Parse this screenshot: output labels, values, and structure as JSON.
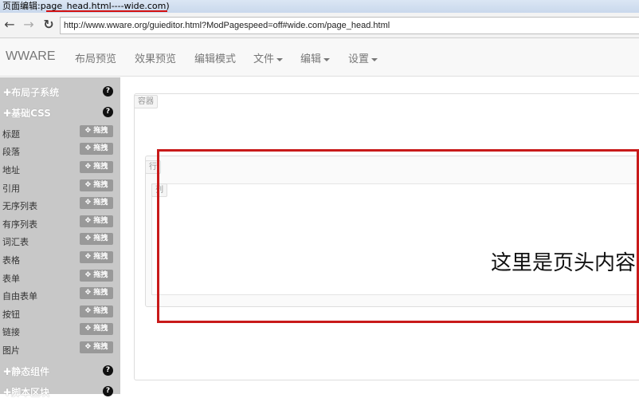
{
  "window": {
    "title": "页面编辑:page_head.html----wide.com)"
  },
  "browser": {
    "back_icon": "back-arrow-icon",
    "forward_icon": "forward-arrow-icon",
    "reload_icon": "reload-icon",
    "url": "http://www.wware.org/guieditor.html?ModPagespeed=off#wide.com/page_head.html"
  },
  "navbar": {
    "brand": "WWARE",
    "items": [
      {
        "label": "布局预览"
      },
      {
        "label": "效果预览"
      },
      {
        "label": "编辑模式"
      },
      {
        "label": "文件"
      },
      {
        "label": "编辑"
      },
      {
        "label": "设置"
      }
    ]
  },
  "sidebar": {
    "sections": [
      {
        "title": "布局子系统"
      },
      {
        "title": "基础CSS"
      },
      {
        "title": "静态组件"
      },
      {
        "title": "脚本区块"
      }
    ],
    "drag_label": "拖拽",
    "items": [
      {
        "label": "标题"
      },
      {
        "label": "段落"
      },
      {
        "label": "地址"
      },
      {
        "label": "引用"
      },
      {
        "label": "无序列表"
      },
      {
        "label": "有序列表"
      },
      {
        "label": "词汇表"
      },
      {
        "label": "表格"
      },
      {
        "label": "表单"
      },
      {
        "label": "自由表单"
      },
      {
        "label": "按钮"
      },
      {
        "label": "链接"
      },
      {
        "label": "图片"
      }
    ]
  },
  "canvas": {
    "container_tag": "容器",
    "row_tag": "行",
    "col_tag": "列",
    "head_text": "这里是页头内容"
  },
  "colors": {
    "highlight": "#c81a1a",
    "sidebar": "#c8c8c8"
  }
}
